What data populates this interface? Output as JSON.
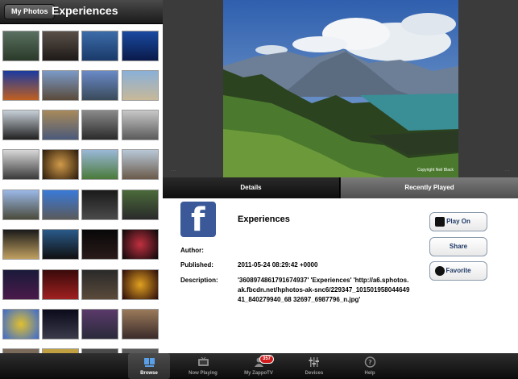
{
  "left_panel": {
    "back_button": "My Photos",
    "title": "Experiences"
  },
  "preview": {
    "prev_ghost": "...",
    "next_ghost": "...",
    "credit": "Copyright Neil Black"
  },
  "tabs": [
    {
      "label": "Details"
    },
    {
      "label": "Recently Played"
    }
  ],
  "details": {
    "title": "Experiences",
    "author_label": "Author:",
    "author_value": "",
    "published_label": "Published:",
    "published_value": "2011-05-24 08:29:42 +0000",
    "description_label": "Description:",
    "description_value": "'3608974861791674937' 'Experiences' 'http://a6.sphotos.ak.fbcdn.net/hphotos-ak-snc6/229347_10150195804464941_840279940_68 32697_6987796_n.jpg'",
    "buttons": {
      "play_on": "Play On",
      "share": "Share",
      "favorite": "Favorite"
    }
  },
  "bottom_bar": {
    "browse": "Browse",
    "now_playing": "Now Playing",
    "my_zappotv": "My ZappoTV",
    "badge": "357",
    "devices": "Devices",
    "help": "Help"
  }
}
